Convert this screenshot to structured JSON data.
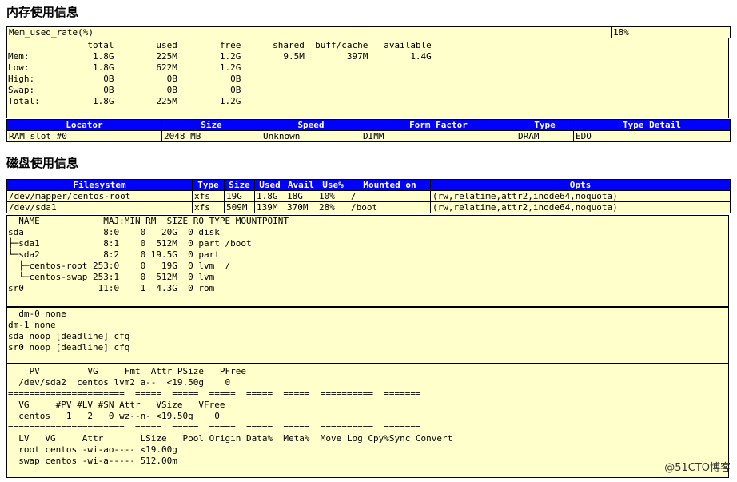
{
  "mem_section": {
    "title": "内存使用信息",
    "rate_label": "Mem_used_rate(%)",
    "rate_value": "18%",
    "free_output": "               total        used        free      shared  buff/cache   available\nMem:            1.8G        225M        1.2G        9.5M        397M        1.4G\nLow:            1.8G        622M        1.2G\nHigh:             0B          0B          0B\nSwap:             0B          0B          0B\nTotal:          1.8G        225M        1.2G",
    "ram_headers": [
      "Locator",
      "Size",
      "Speed",
      "Form Factor",
      "Type",
      "Type Detail"
    ],
    "ram_row": [
      "RAM slot #0",
      "2048 MB",
      "Unknown",
      "DIMM",
      "DRAM",
      "EDO"
    ]
  },
  "disk_section": {
    "title": "磁盘使用信息",
    "fs_headers": [
      "Filesystem",
      "Type",
      "Size",
      "Used",
      "Avail",
      "Use%",
      "Mounted on",
      "Opts"
    ],
    "fs_rows": [
      [
        "/dev/mapper/centos-root",
        "xfs",
        "19G",
        "1.8G",
        "18G",
        "10%",
        "/",
        "(rw,relatime,attr2,inode64,noquota)"
      ],
      [
        "/dev/sda1",
        "xfs",
        "509M",
        "139M",
        "370M",
        "28%",
        "/boot",
        "(rw,relatime,attr2,inode64,noquota)"
      ]
    ],
    "lsblk_output": "  NAME            MAJ:MIN RM  SIZE RO TYPE MOUNTPOINT\nsda               8:0    0   20G  0 disk\n├─sda1            8:1    0  512M  0 part /boot\n└─sda2            8:2    0 19.5G  0 part\n  ├─centos-root 253:0    0   19G  0 lvm  /\n  └─centos-swap 253:1    0  512M  0 lvm\nsr0              11:0    1  4.3G  0 rom",
    "scheduler_output": "  dm-0 none\ndm-1 none\nsda noop [deadline] cfq\nsr0 noop [deadline] cfq",
    "lvm_output": "    PV         VG     Fmt  Attr PSize   PFree\n  /dev/sda2  centos lvm2 a--  <19.50g    0\n======================  =====  =====  =====  =====  =====  ==========  =======\n  VG     #PV #LV #SN Attr   VSize   VFree\n  centos   1   2   0 wz--n- <19.50g    0\n======================  =====  =====  =====  =====  =====  ==========  =======\n  LV   VG     Attr       LSize   Pool Origin Data%  Meta%  Move Log Cpy%Sync Convert\n  root centos -wi-ao---- <19.00g\n  swap centos -wi-a----- 512.00m"
  },
  "watermark": "@51CTO博客"
}
